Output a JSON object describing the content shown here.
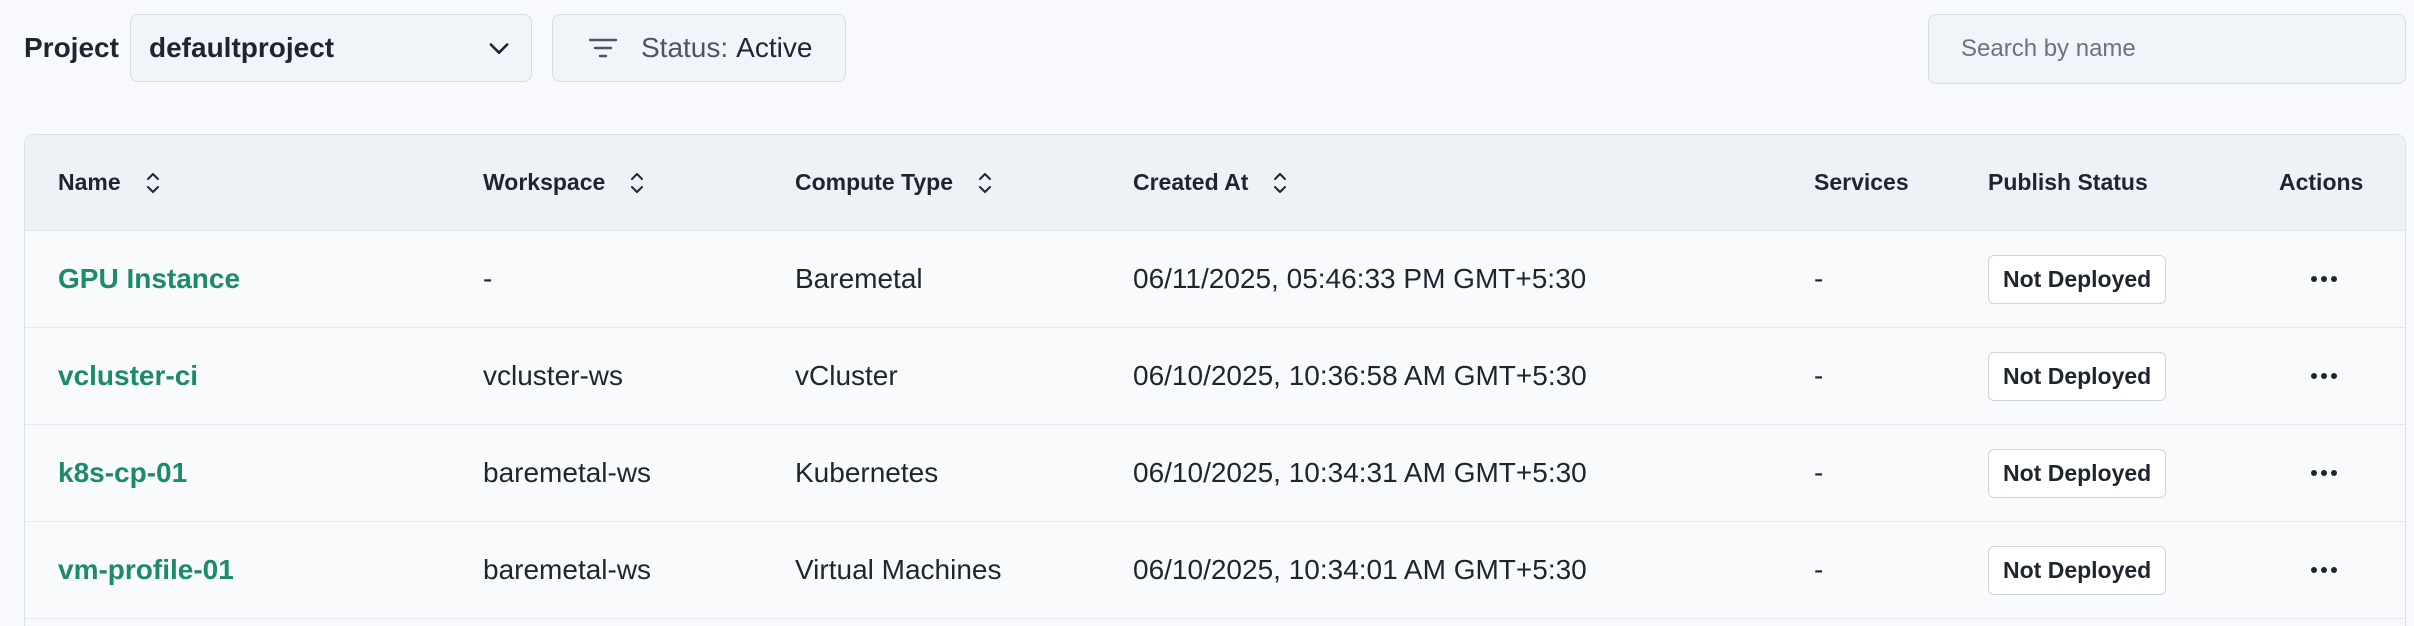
{
  "toolbar": {
    "project_label": "Project",
    "project_value": "defaultproject",
    "status_key": "Status:",
    "status_value": "Active",
    "search_placeholder": "Search by name"
  },
  "table": {
    "columns": [
      {
        "label": "Name",
        "sortable": true
      },
      {
        "label": "Workspace",
        "sortable": true
      },
      {
        "label": "Compute Type",
        "sortable": true
      },
      {
        "label": "Created At",
        "sortable": true
      },
      {
        "label": "Services",
        "sortable": false
      },
      {
        "label": "Publish Status",
        "sortable": false
      },
      {
        "label": "Actions",
        "sortable": false
      }
    ],
    "rows": [
      {
        "name": "GPU Instance",
        "workspace": "-",
        "compute_type": "Baremetal",
        "created_at": "06/11/2025, 05:46:33 PM GMT+5:30",
        "services": "-",
        "publish_status": "Not Deployed"
      },
      {
        "name": "vcluster-ci",
        "workspace": "vcluster-ws",
        "compute_type": "vCluster",
        "created_at": "06/10/2025, 10:36:58 AM GMT+5:30",
        "services": "-",
        "publish_status": "Not Deployed"
      },
      {
        "name": "k8s-cp-01",
        "workspace": "baremetal-ws",
        "compute_type": "Kubernetes",
        "created_at": "06/10/2025, 10:34:31 AM GMT+5:30",
        "services": "-",
        "publish_status": "Not Deployed"
      },
      {
        "name": "vm-profile-01",
        "workspace": "baremetal-ws",
        "compute_type": "Virtual Machines",
        "created_at": "06/10/2025, 10:34:01 AM GMT+5:30",
        "services": "-",
        "publish_status": "Not Deployed"
      }
    ]
  },
  "icons": {
    "project_dropdown": "chevron-down-icon",
    "status_filter": "filter-icon",
    "sort": "sort-icon",
    "row_actions": "more-horizontal-icon"
  },
  "colors": {
    "link": "#1d8a6c",
    "background": "#f7f9fc",
    "header_background": "#eef2f7"
  }
}
